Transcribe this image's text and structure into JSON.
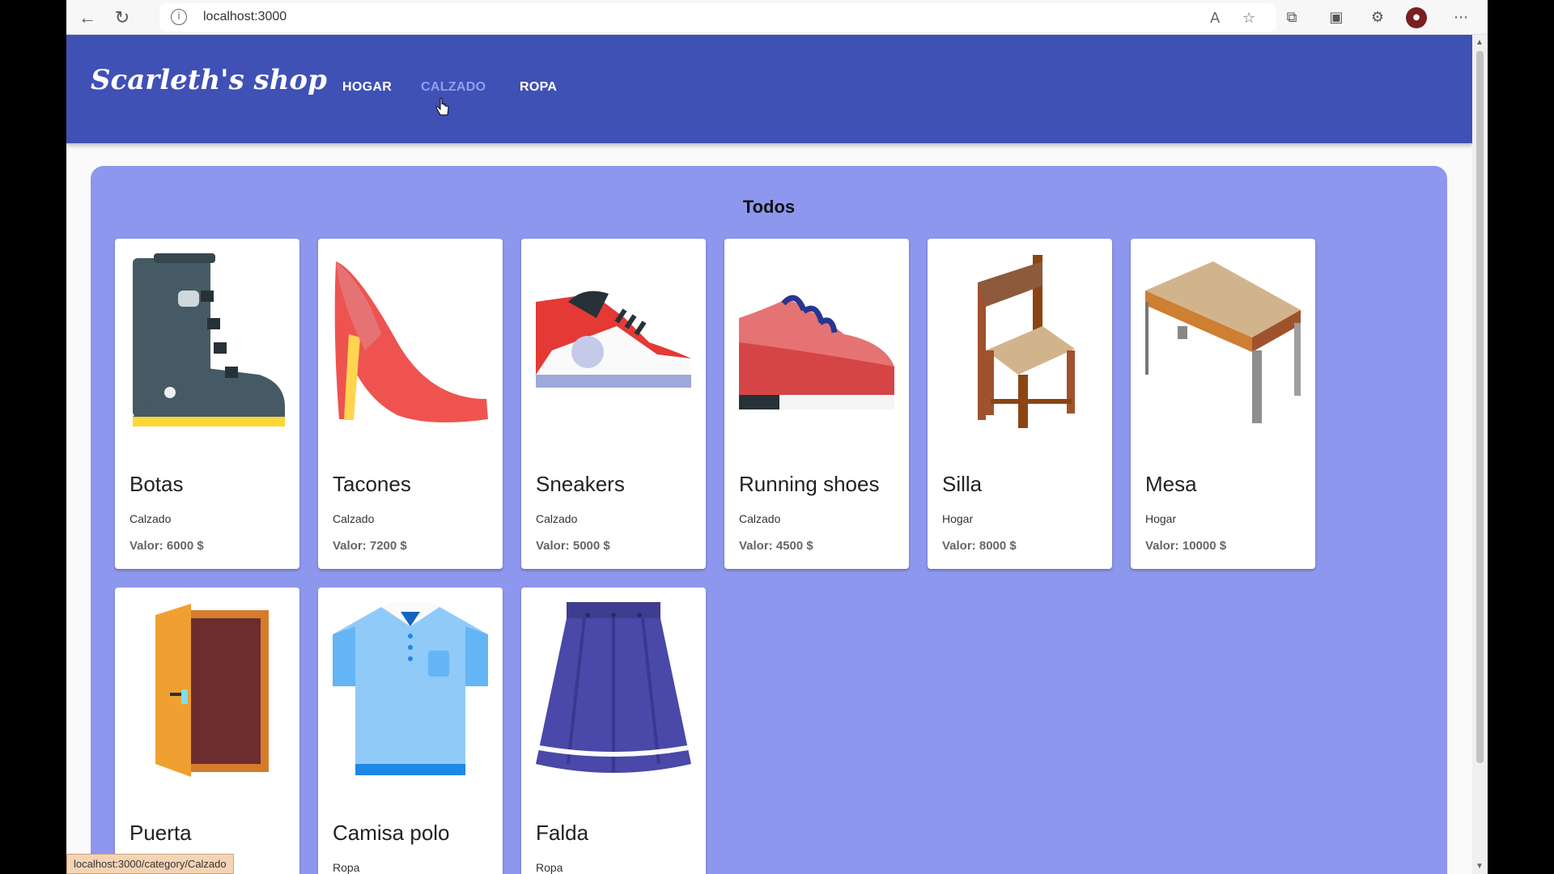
{
  "browser": {
    "url": "localhost:3000",
    "back_icon": "back-arrow-icon",
    "reload_icon": "reload-icon",
    "status_url": "localhost:3000/category/Calzado"
  },
  "app": {
    "brand": "Scarleth's shop",
    "menu": [
      {
        "label": "HOGAR",
        "active": false
      },
      {
        "label": "CALZADO",
        "active": true
      },
      {
        "label": "ROPA",
        "active": false
      }
    ]
  },
  "section": {
    "title": "Todos"
  },
  "products": [
    {
      "name": "Botas",
      "category": "Calzado",
      "price": "Valor: 6000 $",
      "icon": "boot-icon"
    },
    {
      "name": "Tacones",
      "category": "Calzado",
      "price": "Valor: 7200 $",
      "icon": "high-heel-icon"
    },
    {
      "name": "Sneakers",
      "category": "Calzado",
      "price": "Valor: 5000 $",
      "icon": "sneaker-icon"
    },
    {
      "name": "Running shoes",
      "category": "Calzado",
      "price": "Valor: 4500 $",
      "icon": "running-shoe-icon"
    },
    {
      "name": "Silla",
      "category": "Hogar",
      "price": "Valor: 8000 $",
      "icon": "chair-icon"
    },
    {
      "name": "Mesa",
      "category": "Hogar",
      "price": "Valor: 10000 $",
      "icon": "table-icon"
    },
    {
      "name": "Puerta",
      "category": "",
      "price": "",
      "icon": "door-icon"
    },
    {
      "name": "Camisa polo",
      "category": "Ropa",
      "price": "",
      "icon": "polo-shirt-icon"
    },
    {
      "name": "Falda",
      "category": "Ropa",
      "price": "",
      "icon": "skirt-icon"
    }
  ],
  "colors": {
    "appbar": "#3f51b5",
    "panel": "#8e97ee",
    "active_menu": "#8fa0f0"
  }
}
